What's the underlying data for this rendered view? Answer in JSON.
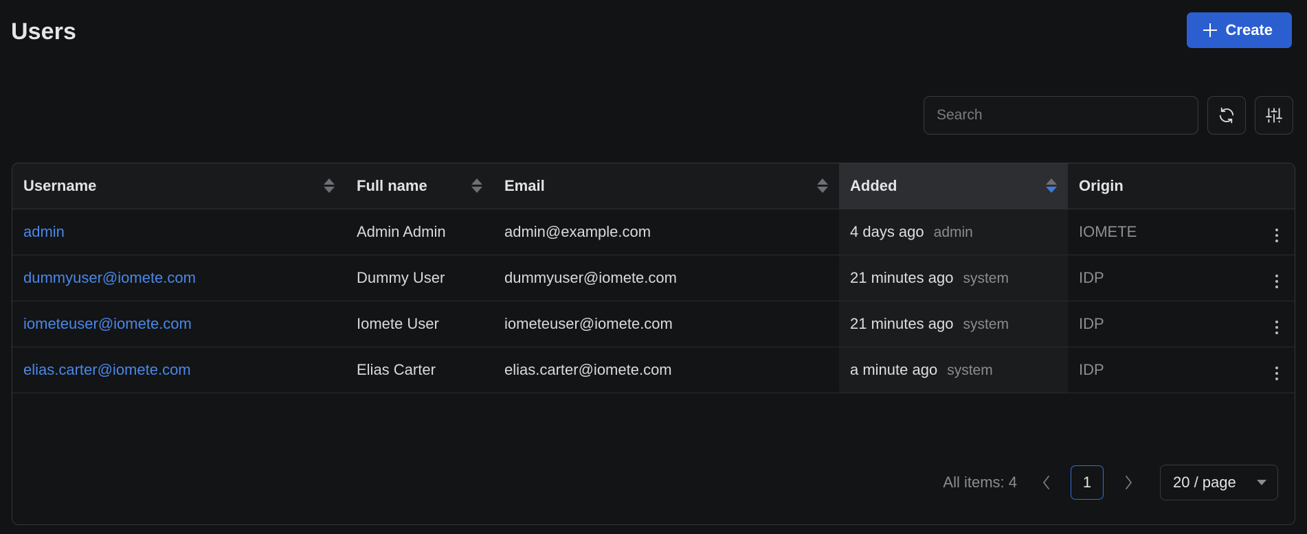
{
  "header": {
    "title": "Users",
    "create_label": "Create"
  },
  "toolbar": {
    "search_placeholder": "Search",
    "search_value": "",
    "refresh_title": "Refresh",
    "filter_title": "Filter"
  },
  "table": {
    "columns": [
      {
        "label": "Username",
        "sortable": true,
        "sort": "none"
      },
      {
        "label": "Full name",
        "sortable": true,
        "sort": "none"
      },
      {
        "label": "Email",
        "sortable": true,
        "sort": "none"
      },
      {
        "label": "Added",
        "sortable": true,
        "sort": "desc"
      },
      {
        "label": "Origin",
        "sortable": false,
        "sort": "none"
      }
    ],
    "rows": [
      {
        "username": "admin",
        "fullname": "Admin Admin",
        "email": "admin@example.com",
        "added_time": "4 days ago",
        "added_actor": "admin",
        "origin": "IOMETE"
      },
      {
        "username": "dummyuser@iomete.com",
        "fullname": "Dummy User",
        "email": "dummyuser@iomete.com",
        "added_time": "21 minutes ago",
        "added_actor": "system",
        "origin": "IDP"
      },
      {
        "username": "iometeuser@iomete.com",
        "fullname": "Iomete User",
        "email": "iometeuser@iomete.com",
        "added_time": "21 minutes ago",
        "added_actor": "system",
        "origin": "IDP"
      },
      {
        "username": "elias.carter@iomete.com",
        "fullname": "Elias Carter",
        "email": "elias.carter@iomete.com",
        "added_time": "a minute ago",
        "added_actor": "system",
        "origin": "IDP"
      }
    ]
  },
  "pagination": {
    "all_items_label": "All items: 4",
    "current_page": "1",
    "page_size_label": "20 / page"
  },
  "colors": {
    "accent_blue": "#2b5fd0",
    "link_blue": "#4a87e8",
    "page_bg": "#121314",
    "header_row_bg": "#191a1c",
    "sorted_col_bg": "#2c2e31"
  }
}
